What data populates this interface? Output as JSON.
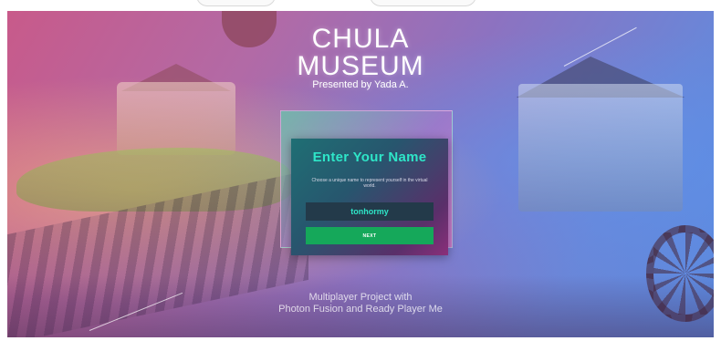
{
  "title": {
    "line1": "CHULA",
    "line2": "MUSEUM",
    "subtitle": "Presented by Yada A."
  },
  "dialog": {
    "heading": "Enter Your Name",
    "help_text": "Choose a unique name to represent yourself in the virtual world.",
    "name_input": {
      "value": "tonhormy"
    },
    "next_button_label": "NEXT"
  },
  "footer": {
    "line1": "Multiplayer Project with",
    "line2": "Photon Fusion and Ready Player Me"
  },
  "colors": {
    "accent_teal": "#2ee6c8",
    "button_green": "#15a85a",
    "input_bg": "#233a4a"
  }
}
